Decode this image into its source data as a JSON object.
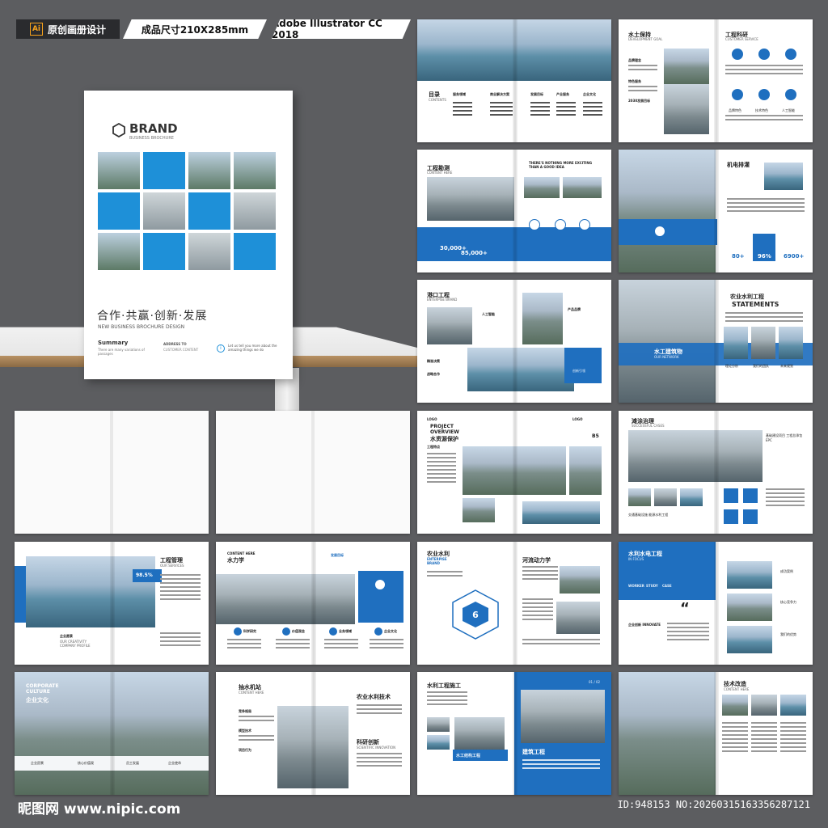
{
  "banner": {
    "tag1": "原创画册设计",
    "tag1_icon": "Ai",
    "tag2": "成品尺寸210X285mm",
    "tag3": "Adobe Illustrator CC 2018"
  },
  "cover": {
    "brand": "BRAND",
    "brand_sub": "BUSINESS BROCHURE",
    "slogan": "合作·共赢·创新·发展",
    "slogan_en": "NEW BUSINESS  BROCHURE DESIGN",
    "summary_title": "Summary",
    "summary_text": "There are many variations of passages",
    "address_title": "ADDRESS TO",
    "address_text": "CUSTOMER CONTENT",
    "note": "Let us tell you more about the amazing things we do"
  },
  "spreads": {
    "s1": {
      "title": "目录",
      "sub": "CONTENTS",
      "cols": [
        "服务领域",
        "商业解决方案",
        "发展目标",
        "产业服务",
        "企业文化"
      ]
    },
    "s2": {
      "title": "水土保持",
      "sub": "DEVELOPMENT GOAL",
      "right_title": "工程科研",
      "right_sub": "CUSTOMER SERVICE",
      "items": [
        "品牌理念",
        "特色服务",
        "2030发展目标"
      ],
      "icons": [
        "品牌特色",
        "技术特色",
        "人工智能"
      ]
    },
    "s3": {
      "title": "工程勘测",
      "sub": "CONTENT HERE",
      "stat1": "30,000+",
      "stat2": "85,000+",
      "note": "THERE'S NOTHING MORE EXCITING THAN A GOOD IDEA"
    },
    "s4": {
      "title": "机电排灌",
      "stats": [
        "80+",
        "96%",
        "6900+"
      ]
    },
    "s5": {
      "title": "港口工程",
      "sub": "ENTERPISE BRAND",
      "labels": [
        "人工智能",
        "产品品牌",
        "精准决策",
        "战略合作",
        "创新引领"
      ]
    },
    "s6": {
      "title": "农业水利工程",
      "sub": "STATEMENTS",
      "band": "水工建筑物",
      "band_sub": "OUR NETWORK",
      "captions": [
        "理论分析",
        "我们的团队",
        "未来规划"
      ]
    },
    "s7": {
      "title": "PROJECT OVERVIEW",
      "cn": "水资源保护",
      "logo": "LOGO",
      "page": "B5",
      "side": "工程特点"
    },
    "s8": {
      "title": "滩涂治理",
      "sub": "SUCCESSFUL CASES",
      "side": "基础建设项目 工程总承包EPC",
      "cap": "交通基础设施 能源水利工程"
    },
    "s10": {
      "title": "工程管理",
      "sub": "OUR SERVICES",
      "stat": "98.5%",
      "foot": "企业愿景",
      "foot_sub": "OUR CREATIVITY COMPANY PROFILE"
    },
    "s11": {
      "title": "水力学",
      "sub": "CONTENT HERE",
      "tag": "发展目标",
      "labels": [
        "科学研究",
        "价值观念",
        "业务领域",
        "企业文化"
      ]
    },
    "s12": {
      "title": "农业水利",
      "sub": "ENTERPISE BRAND",
      "right": "河流动力学",
      "center": "6"
    },
    "s13": {
      "title": "水利水电工程",
      "sub": "IN FOCUS",
      "tabs": [
        "WORKER",
        "STUDY",
        "CASE"
      ],
      "items": [
        "成功案例",
        "核心竞争力",
        "我们的优势"
      ],
      "foot": "企业创新 INNOVATE"
    },
    "s14": {
      "title": "CORPORATE CULTURE",
      "cn": "企业文化",
      "labels": [
        "企业愿景",
        "核心价值观",
        "员工发展",
        "企业使命"
      ]
    },
    "s15": {
      "title": "抽水机站",
      "sub": "CONTENT HERE",
      "right": "农业水利技术",
      "items": [
        "竞争格局",
        "模型技术",
        "项目行为"
      ],
      "right2": "科研创新",
      "right2_sub": "SCIENTIFIC INNOVATION"
    },
    "s16": {
      "title": "水利工程施工",
      "band": "水工结构工程",
      "right": "建筑工程",
      "page": "01 / 02"
    },
    "s17": {
      "title": "技术改造",
      "sub": "CONTENT HERE"
    }
  },
  "footer": {
    "left": "昵图网 www.nipic.com",
    "right": "ID:948153 NO:20260315163356287121"
  }
}
